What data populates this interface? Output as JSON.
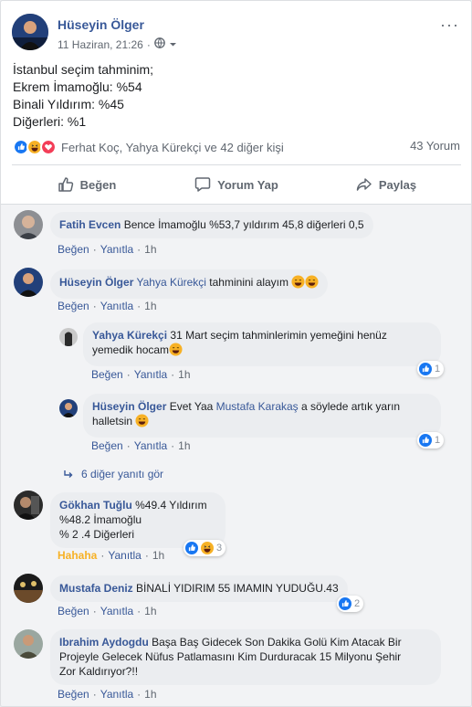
{
  "post": {
    "author": "Hüseyin Ölger",
    "date": "11 Haziran, 21:26",
    "dot": "·",
    "more": "···",
    "lines": [
      "İstanbul seçim tahminim;",
      "Ekrem İmamoğlu: %54",
      "Binali Yıldırım: %45",
      "Diğerleri: %1"
    ],
    "reaction_names": "Ferhat Koç, Yahya Kürekçi ve 42 diğer kişi",
    "comment_count": "43 Yorum"
  },
  "actions": {
    "like": "Beğen",
    "comment": "Yorum Yap",
    "share": "Paylaş"
  },
  "comment_actions": {
    "like": "Beğen",
    "reply": "Yanıtla",
    "sep": "·",
    "haha": "Hahaha"
  },
  "comments": [
    {
      "name": "Fatih Evcen",
      "text": "Bence İmamoğlu %53,7 yıldırım 45,8 diğerleri 0,5",
      "time": "1h"
    },
    {
      "name": "Hüseyin Ölger",
      "mention": "Yahya Kürekçi",
      "text": " tahminini alayım",
      "time": "1h"
    },
    {
      "name": "Yahya Kürekçi",
      "text": "31 Mart seçim tahminlerimin yemeğini henüz",
      "text2": "yemedik hocam",
      "time": "1h",
      "reactions": "1"
    },
    {
      "name": "Hüseyin Ölger",
      "text": "Evet Yaa ",
      "mention": "Mustafa Karakaş",
      "text_after": " a söylede artık yarın",
      "text2": "halletsin",
      "time": "1h",
      "reactions": "1"
    },
    {
      "name": "Gökhan Tuğlu",
      "text": "%49.4 Yıldırım",
      "text2": "%48.2 İmamoğlu",
      "text3": "% 2 .4 Diğerleri",
      "time": "1h",
      "reactions": "3"
    },
    {
      "name": "Mustafa Deniz",
      "text": "BİNALİ YIDIRIM 55 IMAMIN YUDUĞU.43",
      "time": "1h",
      "reactions": "2"
    },
    {
      "name": "Ibrahim Aydogdu",
      "text": "Başa Baş Gidecek Son Dakika Golü Kim Atacak Bir",
      "text2": "Projeyle Gelecek Nüfus Patlamasını Kim Durduracak 15 Milyonu Şehir",
      "text3": "Zor Kaldırıyor?!!",
      "time": "1h"
    }
  ],
  "more_replies": "6 diğer yanıtı gör",
  "colors": {
    "link": "#385898",
    "like_blue": "#1877f2",
    "haha_yellow": "#f7b125",
    "love_red": "#f33e58",
    "bubble": "#ebedf0"
  },
  "icons": [
    "globe-icon",
    "chevron-down-icon",
    "like-reaction-icon",
    "haha-reaction-icon",
    "love-reaction-icon",
    "thumbs-up-icon",
    "comment-icon",
    "share-icon",
    "reply-arrow-icon",
    "grin-emoji-icon"
  ]
}
